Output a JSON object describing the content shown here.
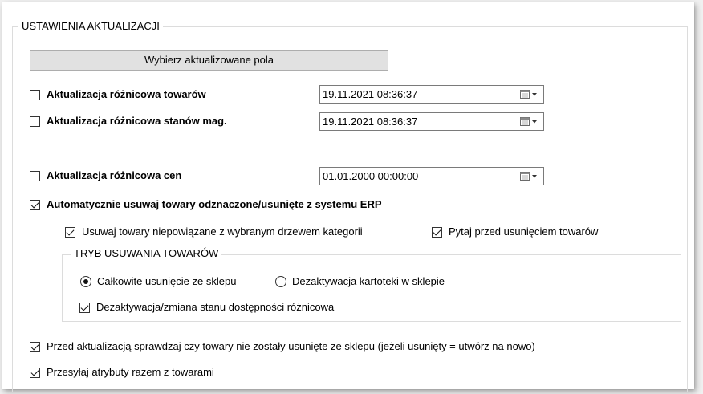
{
  "group_title": "USTAWIENIA AKTUALIZACJI",
  "select_fields_button": "Wybierz aktualizowane pola",
  "diff_products": {
    "label": "Aktualizacja różnicowa towarów",
    "checked": false,
    "datetime": "19.11.2021 08:36:37"
  },
  "diff_stock": {
    "label": "Aktualizacja różnicowa stanów mag.",
    "checked": false,
    "datetime": "19.11.2021 08:36:37"
  },
  "diff_prices": {
    "label": "Aktualizacja różnicowa cen",
    "checked": false,
    "datetime": "01.01.2000 00:00:00"
  },
  "auto_remove": {
    "label": "Automatycznie usuwaj towary odznaczone/usunięte z systemu ERP",
    "checked": true
  },
  "remove_unlinked": {
    "label": "Usuwaj towary niepowiązane z wybranym drzewem kategorii",
    "checked": true
  },
  "ask_before_remove": {
    "label": "Pytaj przed usunięciem towarów",
    "checked": true
  },
  "removal_mode": {
    "title": "TRYB USUWANIA TOWARÓW",
    "options": [
      "Całkowite usunięcie ze sklepu",
      "Dezaktywacja kartoteki w sklepie"
    ],
    "selected": "Całkowite usunięcie ze sklepu",
    "diff_deactivation": {
      "label": "Dezaktywacja/zmiana stanu dostępności różnicowa",
      "checked": true
    }
  },
  "check_before_update": {
    "label": "Przed aktualizacją sprawdzaj czy towary nie zostały usunięte ze sklepu (jeżeli usunięty = utwórz na nowo)",
    "checked": true
  },
  "send_attributes": {
    "label": "Przesyłaj atrybuty razem z towarami",
    "checked": true
  }
}
